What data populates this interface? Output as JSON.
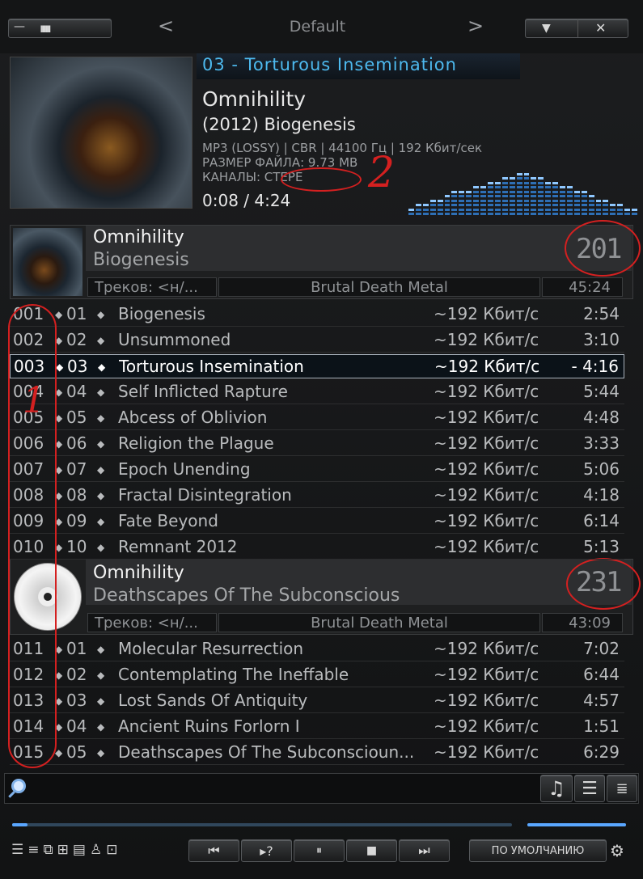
{
  "titlebar": {
    "title": "Default",
    "left_ticks": "ıııııııııı",
    "minimize_icon": "—",
    "close_icon": "✕",
    "prev_arrow": "<",
    "next_arrow": ">"
  },
  "now_playing": {
    "title": "03 - Torturous Insemination",
    "artist": "Omnihility",
    "album": "(2012) Biogenesis",
    "format": "MP3 (LOSSY) | CBR | 44100 Гц | 192 Кбит/сек",
    "filesize": "РАЗМЕР ФАЙЛА: 9.73 MB",
    "channels": "КАНАЛЫ: СТЕРЕ",
    "time": "0:08 / 4:24"
  },
  "spectrum_levels": [
    2,
    3,
    3,
    4,
    4,
    5,
    6,
    6,
    6,
    7,
    7,
    8,
    8,
    9,
    9,
    10,
    10,
    9,
    9,
    8,
    8,
    7,
    7,
    6,
    6,
    5,
    4,
    4,
    3,
    3,
    2,
    2
  ],
  "groups": [
    {
      "artist": "Omnihility",
      "album": "Biogenesis",
      "tracks_label": "Треков: <н/...",
      "genre": "Brutal Death Metal",
      "total": "45:24",
      "big_number": "201"
    },
    {
      "artist": "Omnihility",
      "album": "Deathscapes Of The Subconscious",
      "tracks_label": "Треков: <н/...",
      "genre": "Brutal Death Metal",
      "total": "43:09",
      "big_number": "231"
    }
  ],
  "tracks": [
    {
      "idx": "001",
      "num": "01",
      "title": "Biogenesis",
      "bitrate": "~192 Кбит/с",
      "duration": "2:54",
      "active": false
    },
    {
      "idx": "002",
      "num": "02",
      "title": "Unsummoned",
      "bitrate": "~192 Кбит/с",
      "duration": "3:10",
      "active": false
    },
    {
      "idx": "003",
      "num": "03",
      "title": "Torturous Insemination",
      "bitrate": "~192 Кбит/с",
      "duration": "- 4:16",
      "active": true
    },
    {
      "idx": "004",
      "num": "04",
      "title": "Self Inflicted Rapture",
      "bitrate": "~192 Кбит/с",
      "duration": "5:44",
      "active": false
    },
    {
      "idx": "005",
      "num": "05",
      "title": "Abcess of Oblivion",
      "bitrate": "~192 Кбит/с",
      "duration": "4:48",
      "active": false
    },
    {
      "idx": "006",
      "num": "06",
      "title": "Religion the Plague",
      "bitrate": "~192 Кбит/с",
      "duration": "3:33",
      "active": false
    },
    {
      "idx": "007",
      "num": "07",
      "title": "Epoch Unending",
      "bitrate": "~192 Кбит/с",
      "duration": "5:06",
      "active": false
    },
    {
      "idx": "008",
      "num": "08",
      "title": "Fractal Disintegration",
      "bitrate": "~192 Кбит/с",
      "duration": "4:18",
      "active": false
    },
    {
      "idx": "009",
      "num": "09",
      "title": "Fate Beyond",
      "bitrate": "~192 Кбит/с",
      "duration": "6:14",
      "active": false
    },
    {
      "idx": "010",
      "num": "10",
      "title": "Remnant 2012",
      "bitrate": "~192 Кбит/с",
      "duration": "5:13",
      "active": false
    },
    {
      "idx": "011",
      "num": "01",
      "title": "Molecular Resurrection",
      "bitrate": "~192 Кбит/с",
      "duration": "7:02",
      "active": false
    },
    {
      "idx": "012",
      "num": "02",
      "title": "Contemplating The Ineffable",
      "bitrate": "~192 Кбит/с",
      "duration": "6:44",
      "active": false
    },
    {
      "idx": "013",
      "num": "03",
      "title": "Lost Sands Of Antiquity",
      "bitrate": "~192 Кбит/с",
      "duration": "4:57",
      "active": false
    },
    {
      "idx": "014",
      "num": "04",
      "title": "Ancient Ruins Forlorn I",
      "bitrate": "~192 Кбит/с",
      "duration": "1:51",
      "active": false
    },
    {
      "idx": "015",
      "num": "05",
      "title": "Deathscapes Of The Subconscioun...",
      "bitrate": "~192 Кбит/с",
      "duration": "6:29",
      "active": false
    }
  ],
  "playback": {
    "progress_fraction": 0.03,
    "volume_fraction": 1.0
  },
  "controls": {
    "prev": "⏮",
    "playpause_hint": "▸?",
    "pause": "⏸",
    "stop": "■",
    "next": "⏭",
    "preset_label": "ПО УМОЛЧАНИЮ",
    "gear": "⚙"
  },
  "annotations": {
    "mark_2": "2",
    "mark_1": "1"
  }
}
